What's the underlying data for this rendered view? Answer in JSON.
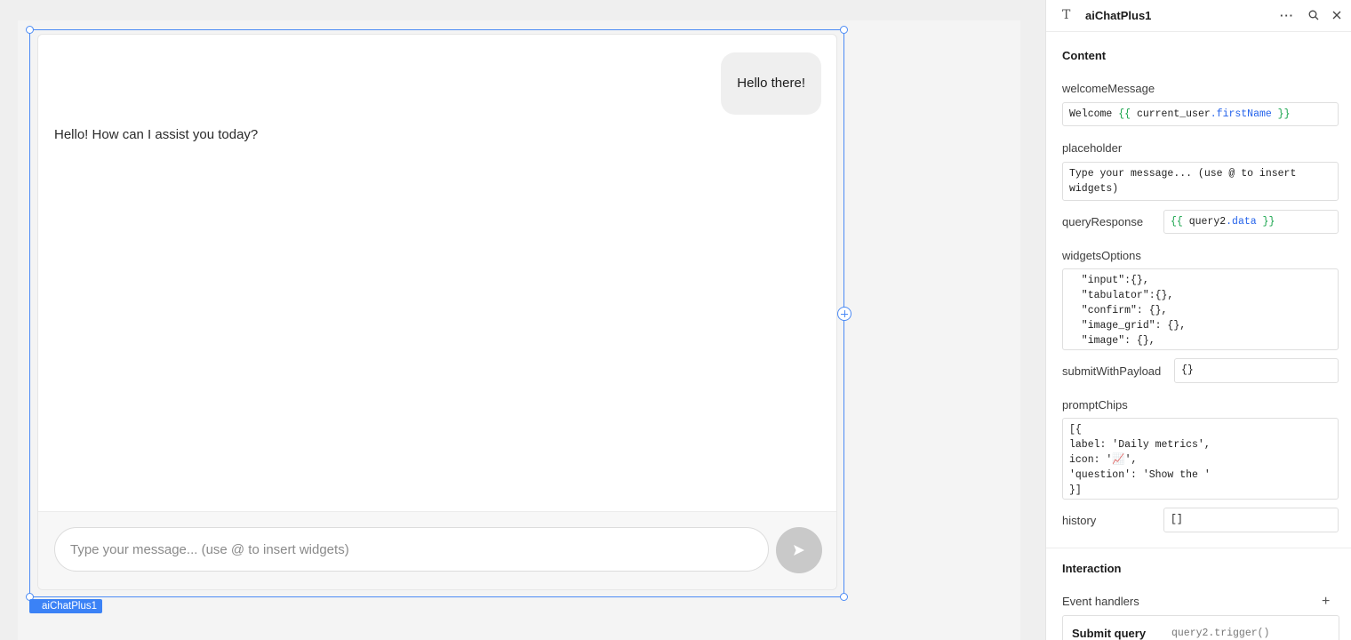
{
  "chat": {
    "user_message": "Hello there!",
    "bot_message": "Hello! How can I assist you today?",
    "input_placeholder": "Type your message... (use @ to insert widgets)",
    "widget_tag": "aiChatPlus1"
  },
  "inspector": {
    "component_type_icon": "text-type-icon",
    "title": "aiChatPlus1",
    "header_icons": [
      "more-icon",
      "search-icon",
      "close-icon"
    ],
    "content_section": "Content",
    "fields": {
      "welcomeMessage": {
        "label": "welcomeMessage",
        "prefix": "Welcome ",
        "open": "{{ ",
        "ident": "current_user",
        "prop": ".firstName",
        "close": " }}"
      },
      "placeholder": {
        "label": "placeholder",
        "value": "Type your message... (use @ to insert\nwidgets)"
      },
      "queryResponse": {
        "label": "queryResponse",
        "open": "{{ ",
        "ident": "query2",
        "prop": ".data",
        "close": " }}"
      },
      "widgetsOptions": {
        "label": "widgetsOptions",
        "value": "  \"input\":{},\n  \"tabulator\":{},\n  \"confirm\": {},\n  \"image_grid\": {},\n  \"image\": {},\n  \"----\": {}"
      },
      "submitWithPayload": {
        "label": "submitWithPayload",
        "value": "{}"
      },
      "promptChips": {
        "label": "promptChips",
        "value": "[{\nlabel: 'Daily metrics',\nicon: '📈',\n'question': 'Show the '\n}]"
      },
      "history": {
        "label": "history",
        "value": "[]"
      }
    },
    "interaction_section": "Interaction",
    "event_handlers_label": "Event handlers",
    "event_handler": {
      "name": "Submit query",
      "action": "query2.trigger()"
    }
  },
  "colors": {
    "selection": "#4c8bf5",
    "tag_bg": "#3b82f6",
    "code_brace": "#16a34a",
    "code_prop": "#2563eb"
  }
}
